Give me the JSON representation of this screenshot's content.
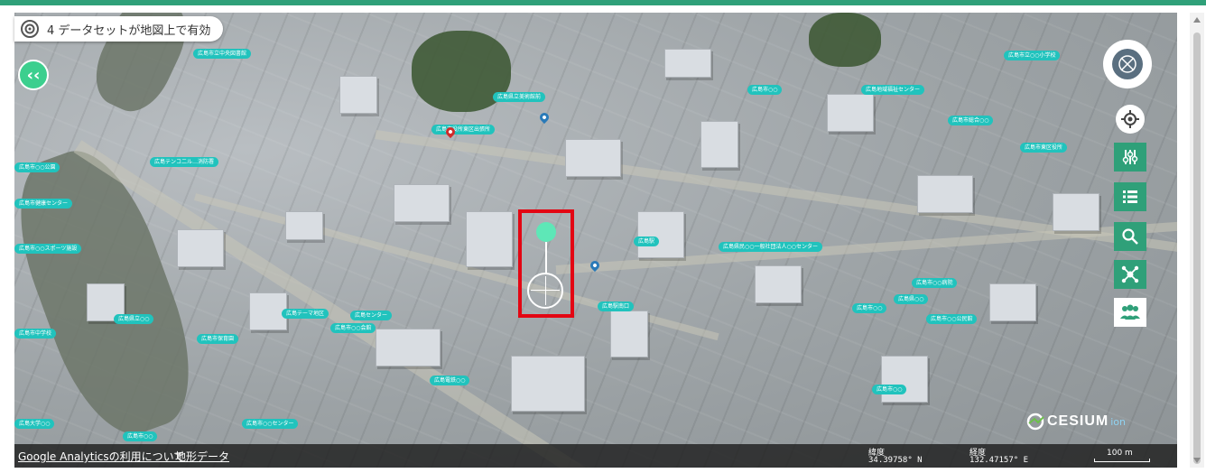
{
  "badge": {
    "text": "4 データセットが地図上で有効",
    "icon": "dataset-radio-icon"
  },
  "collapse_button": {
    "symbol": "‹‹"
  },
  "map_controls": {
    "compass": "compass-icon",
    "locate": "locate-icon",
    "tools": [
      "filter-sliders-icon",
      "list-icon",
      "search-icon",
      "share-network-icon",
      "people-icon"
    ]
  },
  "poi_labels": [
    "広島市立中央図書館",
    "広島県立美術館前",
    "広島市立○○小学校",
    "広島市役所東区出張所",
    "広島テンコ二ル…消防署",
    "広島市○○",
    "広島県民○○一般社団法人○○センター",
    "広島地域福祉センター",
    "広島駅",
    "広島駅南口",
    "広島市総合○○",
    "広島市東区役所",
    "広島市○○公園",
    "広島市健康センター",
    "広島市○○スポーツ施設",
    "広島市○○病院",
    "広島県○○",
    "広島市○○",
    "広島テーマ地区",
    "広島センター",
    "広島市○○公民館",
    "広島県立○○",
    "広島市中学校",
    "広島市保育園",
    "広島市○○会館",
    "広島電鉄○○",
    "広島市○○",
    "広島大学○○",
    "広島市○○センター",
    "広島市○○"
  ],
  "attribution": {
    "cesium": "CESIUM",
    "ion": "ion"
  },
  "bottom_bar": {
    "analytics_link": "Google Analyticsの利用について",
    "terrain_link": "地形データ",
    "latitude_label": "緯度",
    "latitude_value": "34.39758° N",
    "longitude_label": "経度",
    "longitude_value": "132.47157° E",
    "scale_label": "100 m"
  },
  "colors": {
    "accent": "#2fa079",
    "label": "#21c3bd",
    "highlight": "#e30613",
    "focus": "#5ee7b7"
  }
}
